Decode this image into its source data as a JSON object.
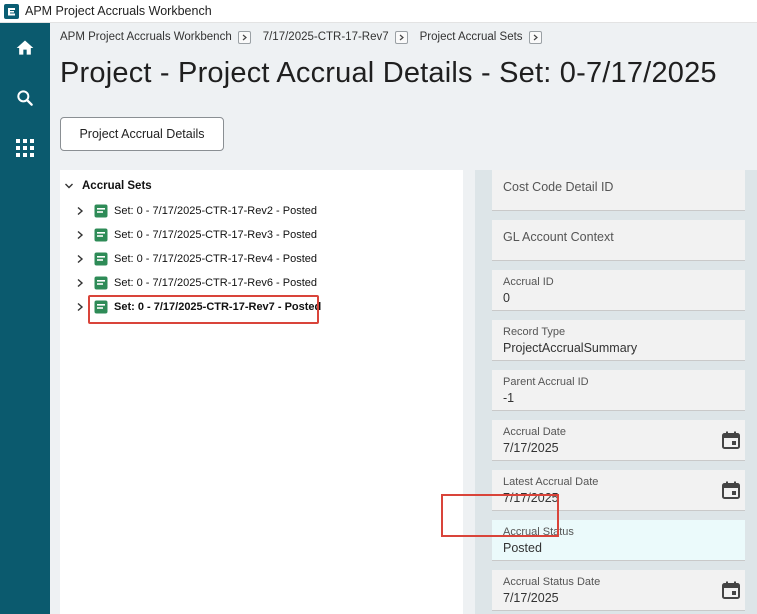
{
  "app": {
    "title": "APM Project Accruals Workbench"
  },
  "rail": {
    "items": [
      {
        "icon": "home-icon"
      },
      {
        "icon": "search-icon"
      },
      {
        "icon": "apps-grid-icon"
      }
    ]
  },
  "breadcrumb": {
    "items": [
      {
        "label": "APM Project Accruals Workbench"
      },
      {
        "label": "7/17/2025-CTR-17-Rev7"
      },
      {
        "label": "Project Accrual Sets"
      }
    ]
  },
  "page": {
    "title": "Project - Project Accrual Details - Set: 0-7/17/2025"
  },
  "tab": {
    "label": "Project Accrual Details"
  },
  "tree": {
    "root_label": "Accrual Sets",
    "items": [
      {
        "label": "Set: 0 - 7/17/2025-CTR-17-Rev2 - Posted"
      },
      {
        "label": "Set: 0 - 7/17/2025-CTR-17-Rev3 - Posted"
      },
      {
        "label": "Set: 0 - 7/17/2025-CTR-17-Rev4 - Posted"
      },
      {
        "label": "Set: 0 - 7/17/2025-CTR-17-Rev6 - Posted"
      },
      {
        "label": "Set: 0 - 7/17/2025-CTR-17-Rev7 - Posted"
      }
    ]
  },
  "form": {
    "cost_code_detail_id": {
      "label": "Cost Code Detail ID"
    },
    "gl_account_context": {
      "label": "GL Account Context"
    },
    "accrual_id": {
      "label": "Accrual ID",
      "value": "0"
    },
    "record_type": {
      "label": "Record Type",
      "value": "ProjectAccrualSummary"
    },
    "parent_accrual_id": {
      "label": "Parent Accrual ID",
      "value": "-1"
    },
    "accrual_date": {
      "label": "Accrual Date",
      "value": "7/17/2025"
    },
    "latest_accrual_date": {
      "label": "Latest Accrual Date",
      "value": "7/17/2025"
    },
    "accrual_status": {
      "label": "Accrual Status",
      "value": "Posted"
    },
    "accrual_status_date": {
      "label": "Accrual Status Date",
      "value": "7/17/2025"
    }
  },
  "colors": {
    "rail": "#0b5a6e",
    "highlight": "#d9443a",
    "set_icon": "#2e8b57"
  }
}
